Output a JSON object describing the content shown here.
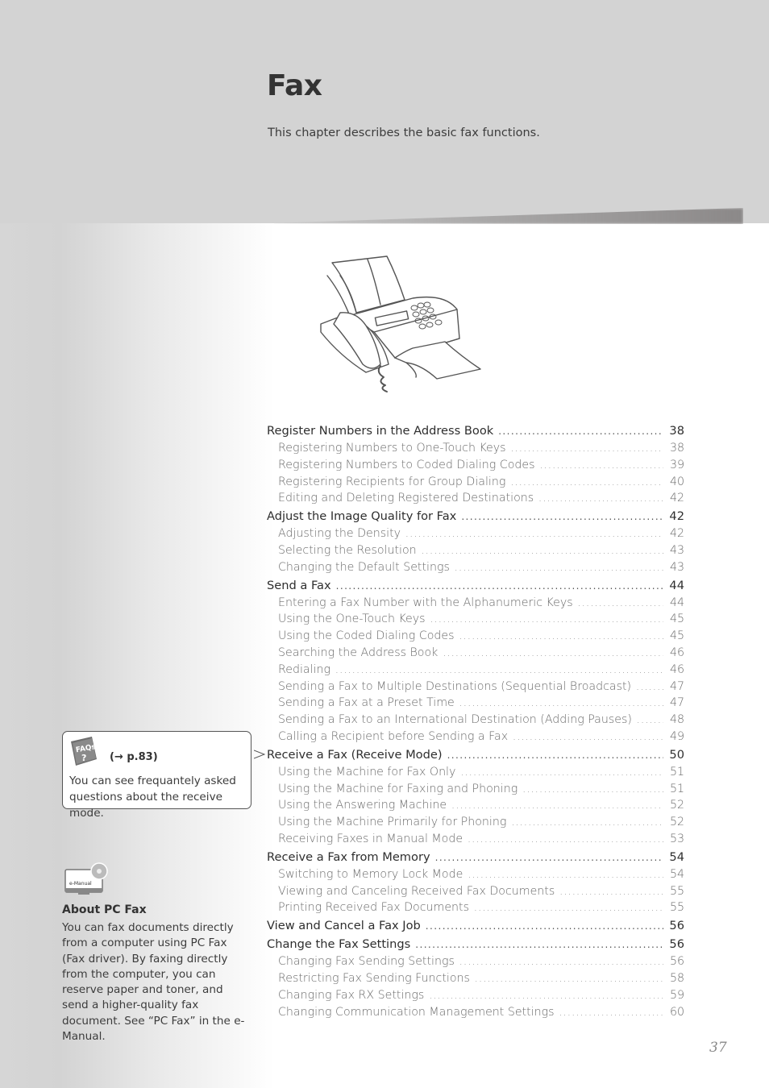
{
  "chapter": {
    "title": "Fax",
    "subtitle": "This chapter describes the basic fax functions."
  },
  "illustration": {
    "icon": "fax-machine-illustration"
  },
  "toc": [
    {
      "level": 1,
      "label": "Register Numbers in the Address Book",
      "page": "38"
    },
    {
      "level": 2,
      "label": "Registering Numbers to One-Touch Keys",
      "page": "38"
    },
    {
      "level": 2,
      "label": "Registering Numbers to Coded Dialing Codes",
      "page": "39"
    },
    {
      "level": 2,
      "label": "Registering Recipients for Group Dialing",
      "page": "40"
    },
    {
      "level": 2,
      "label": "Editing and Deleting Registered Destinations",
      "page": "42"
    },
    {
      "level": 1,
      "label": "Adjust the Image Quality for Fax",
      "page": "42"
    },
    {
      "level": 2,
      "label": "Adjusting the Density",
      "page": "42"
    },
    {
      "level": 2,
      "label": "Selecting the Resolution",
      "page": "43"
    },
    {
      "level": 2,
      "label": "Changing the Default Settings",
      "page": "43"
    },
    {
      "level": 1,
      "label": "Send a Fax",
      "page": "44"
    },
    {
      "level": 2,
      "label": "Entering a Fax Number with the Alphanumeric Keys",
      "page": "44"
    },
    {
      "level": 2,
      "label": "Using the One-Touch Keys",
      "page": "45"
    },
    {
      "level": 2,
      "label": "Using the Coded Dialing Codes",
      "page": "45"
    },
    {
      "level": 2,
      "label": "Searching the Address Book",
      "page": "46"
    },
    {
      "level": 2,
      "label": "Redialing",
      "page": "46"
    },
    {
      "level": 2,
      "label": "Sending a Fax to Multiple Destinations (Sequential Broadcast)",
      "page": "47"
    },
    {
      "level": 2,
      "label": "Sending a Fax at a Preset Time",
      "page": "47"
    },
    {
      "level": 2,
      "label": "Sending a Fax to an International Destination (Adding Pauses)",
      "page": "48"
    },
    {
      "level": 2,
      "label": "Calling a Recipient before Sending a Fax",
      "page": "49"
    },
    {
      "level": 1,
      "label": "Receive a Fax (Receive Mode)",
      "page": "50",
      "pointed": true
    },
    {
      "level": 2,
      "label": "Using the Machine for Fax Only",
      "page": "51"
    },
    {
      "level": 2,
      "label": "Using the Machine for Faxing and Phoning",
      "page": "51"
    },
    {
      "level": 2,
      "label": "Using the Answering Machine",
      "page": "52"
    },
    {
      "level": 2,
      "label": "Using the Machine Primarily for Phoning",
      "page": "52"
    },
    {
      "level": 2,
      "label": "Receiving Faxes in Manual Mode",
      "page": "53"
    },
    {
      "level": 1,
      "label": "Receive a Fax from Memory",
      "page": "54"
    },
    {
      "level": 2,
      "label": "Switching to Memory Lock Mode",
      "page": "54"
    },
    {
      "level": 2,
      "label": "Viewing and Canceling Received Fax Documents",
      "page": "55"
    },
    {
      "level": 2,
      "label": "Printing Received Fax Documents",
      "page": "55"
    },
    {
      "level": 1,
      "label": "View and Cancel a Fax Job",
      "page": "56"
    },
    {
      "level": 1,
      "label": "Change the Fax Settings",
      "page": "56"
    },
    {
      "level": 2,
      "label": "Changing Fax Sending Settings",
      "page": "56"
    },
    {
      "level": 2,
      "label": "Restricting Fax Sending Functions",
      "page": "58"
    },
    {
      "level": 2,
      "label": "Changing Fax RX Settings",
      "page": "59"
    },
    {
      "level": 2,
      "label": "Changing Communication Management Settings",
      "page": "60"
    }
  ],
  "faq": {
    "icon_label": "FAQs",
    "icon_mark": "?",
    "reference": "(→ p.83)",
    "text": "You can see frequantely asked questions about the receive mode."
  },
  "pc_fax": {
    "icon_label": "e-Manual",
    "title": "About PC Fax",
    "body": "You can fax documents directly from a computer using PC Fax (Fax driver). By faxing directly from the computer, you can reserve paper and toner, and send a higher-quality fax document. See “PC Fax” in the e-Manual."
  },
  "page_number": "37"
}
